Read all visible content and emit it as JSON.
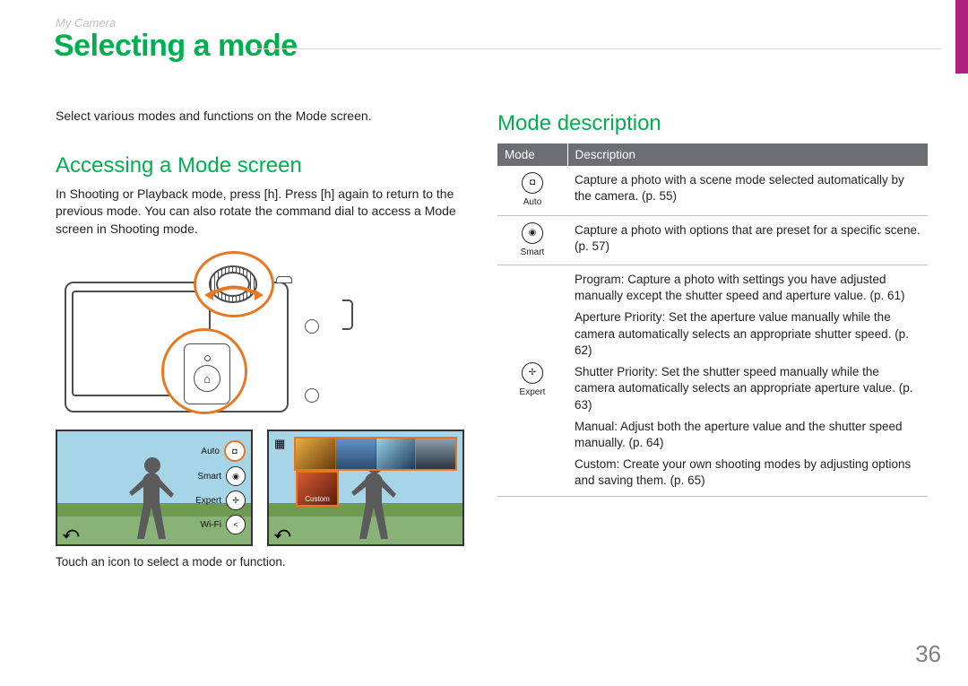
{
  "breadcrumb": "My Camera",
  "title": "Selecting a mode",
  "page_number": "36",
  "left": {
    "intro": "Select various modes and functions on the Mode screen.",
    "h2": "Accessing a Mode screen",
    "body": "In Shooting or Playback mode, press [h]. Press [h] again to return to the previous mode. You can also rotate the command dial to access a Mode screen in Shooting mode.",
    "screen1_modes": [
      "Auto",
      "Smart",
      "Expert",
      "Wi-Fi"
    ],
    "screen2_selected_label": "Custom",
    "caption": "Touch an icon to select a mode or function."
  },
  "right": {
    "h2": "Mode description",
    "table_headers": [
      "Mode",
      "Description"
    ],
    "rows": [
      {
        "icon_name": "auto-mode-icon",
        "glyph": "◘",
        "label": "Auto",
        "desc": "Capture a photo with a scene mode selected automatically by the camera. (p. 55)"
      },
      {
        "icon_name": "smart-mode-icon",
        "glyph": "◉",
        "label": "Smart",
        "desc": "Capture a photo with options that are preset for a specific scene. (p. 57)"
      },
      {
        "icon_name": "expert-mode-icon",
        "glyph": "✢",
        "label": "Expert",
        "sub": [
          {
            "name": "Program",
            "desc": ": Capture a photo with settings you have adjusted manually except the shutter speed and aperture value. (p. 61)"
          },
          {
            "name": "Aperture Priority",
            "desc": ": Set the aperture value manually while the camera automatically selects an appropriate shutter speed. (p. 62)"
          },
          {
            "name": "Shutter Priority",
            "desc": ": Set the shutter speed manually while the camera automatically selects an appropriate aperture value. (p. 63)"
          },
          {
            "name": "Manual",
            "desc": ": Adjust both the aperture value and the shutter speed manually. (p. 64)"
          },
          {
            "name": "Custom",
            "desc": ": Create your own shooting modes by adjusting options and saving them. (p. 65)"
          }
        ]
      }
    ]
  }
}
